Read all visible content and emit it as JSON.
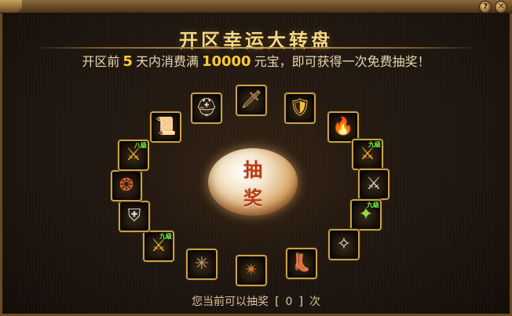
{
  "window": {
    "help_label": "?",
    "close_label": "✕"
  },
  "header": {
    "title": "开区幸运大转盘",
    "sub_prefix": "开区前",
    "sub_days": "5",
    "sub_mid": "天内消费满",
    "sub_amount": "10000",
    "sub_suffix": "元宝，即可获得一次免费抽奖！"
  },
  "wheel": {
    "center_line1": "抽",
    "center_line2": "奖",
    "slots": [
      {
        "name": "dagger-icon",
        "glyph": "🗡",
        "badge": ""
      },
      {
        "name": "golden-armor-icon",
        "glyph": "🛡",
        "badge": ""
      },
      {
        "name": "red-armor-icon",
        "glyph": "🔥",
        "badge": ""
      },
      {
        "name": "upgrade-armor-icon",
        "glyph": "⚔",
        "badge": "九级"
      },
      {
        "name": "sword-icon",
        "glyph": "⚔",
        "badge": ""
      },
      {
        "name": "green-wand-icon",
        "glyph": "✦",
        "badge": "九级"
      },
      {
        "name": "claw-icon",
        "glyph": "✧",
        "badge": ""
      },
      {
        "name": "gold-boots-icon",
        "glyph": "👢",
        "badge": ""
      },
      {
        "name": "crossed-blades-icon",
        "glyph": "✴",
        "badge": ""
      },
      {
        "name": "spiked-weapon-icon",
        "glyph": "✳",
        "badge": ""
      },
      {
        "name": "upgrade-armor-icon-2",
        "glyph": "⚔",
        "badge": "九级"
      },
      {
        "name": "silver-armor-icon",
        "glyph": "⛨",
        "badge": ""
      },
      {
        "name": "belt-icon",
        "glyph": "❂",
        "badge": ""
      },
      {
        "name": "upgrade-armor-icon-3",
        "glyph": "⚔",
        "badge": "八级"
      },
      {
        "name": "scroll-icon",
        "glyph": "📜",
        "badge": ""
      },
      {
        "name": "helmet-icon",
        "glyph": "⛑",
        "badge": ""
      }
    ]
  },
  "footer": {
    "prefix": "您当前可以抽奖",
    "count_open": "[",
    "count": "0",
    "count_close": "]",
    "suffix": "次"
  },
  "colors": {
    "gold_border": "#c8a04a",
    "title": "#f3d98a",
    "highlight": "#ffcc33",
    "badge": "#7dff4a",
    "center_text": "#b83a12"
  }
}
